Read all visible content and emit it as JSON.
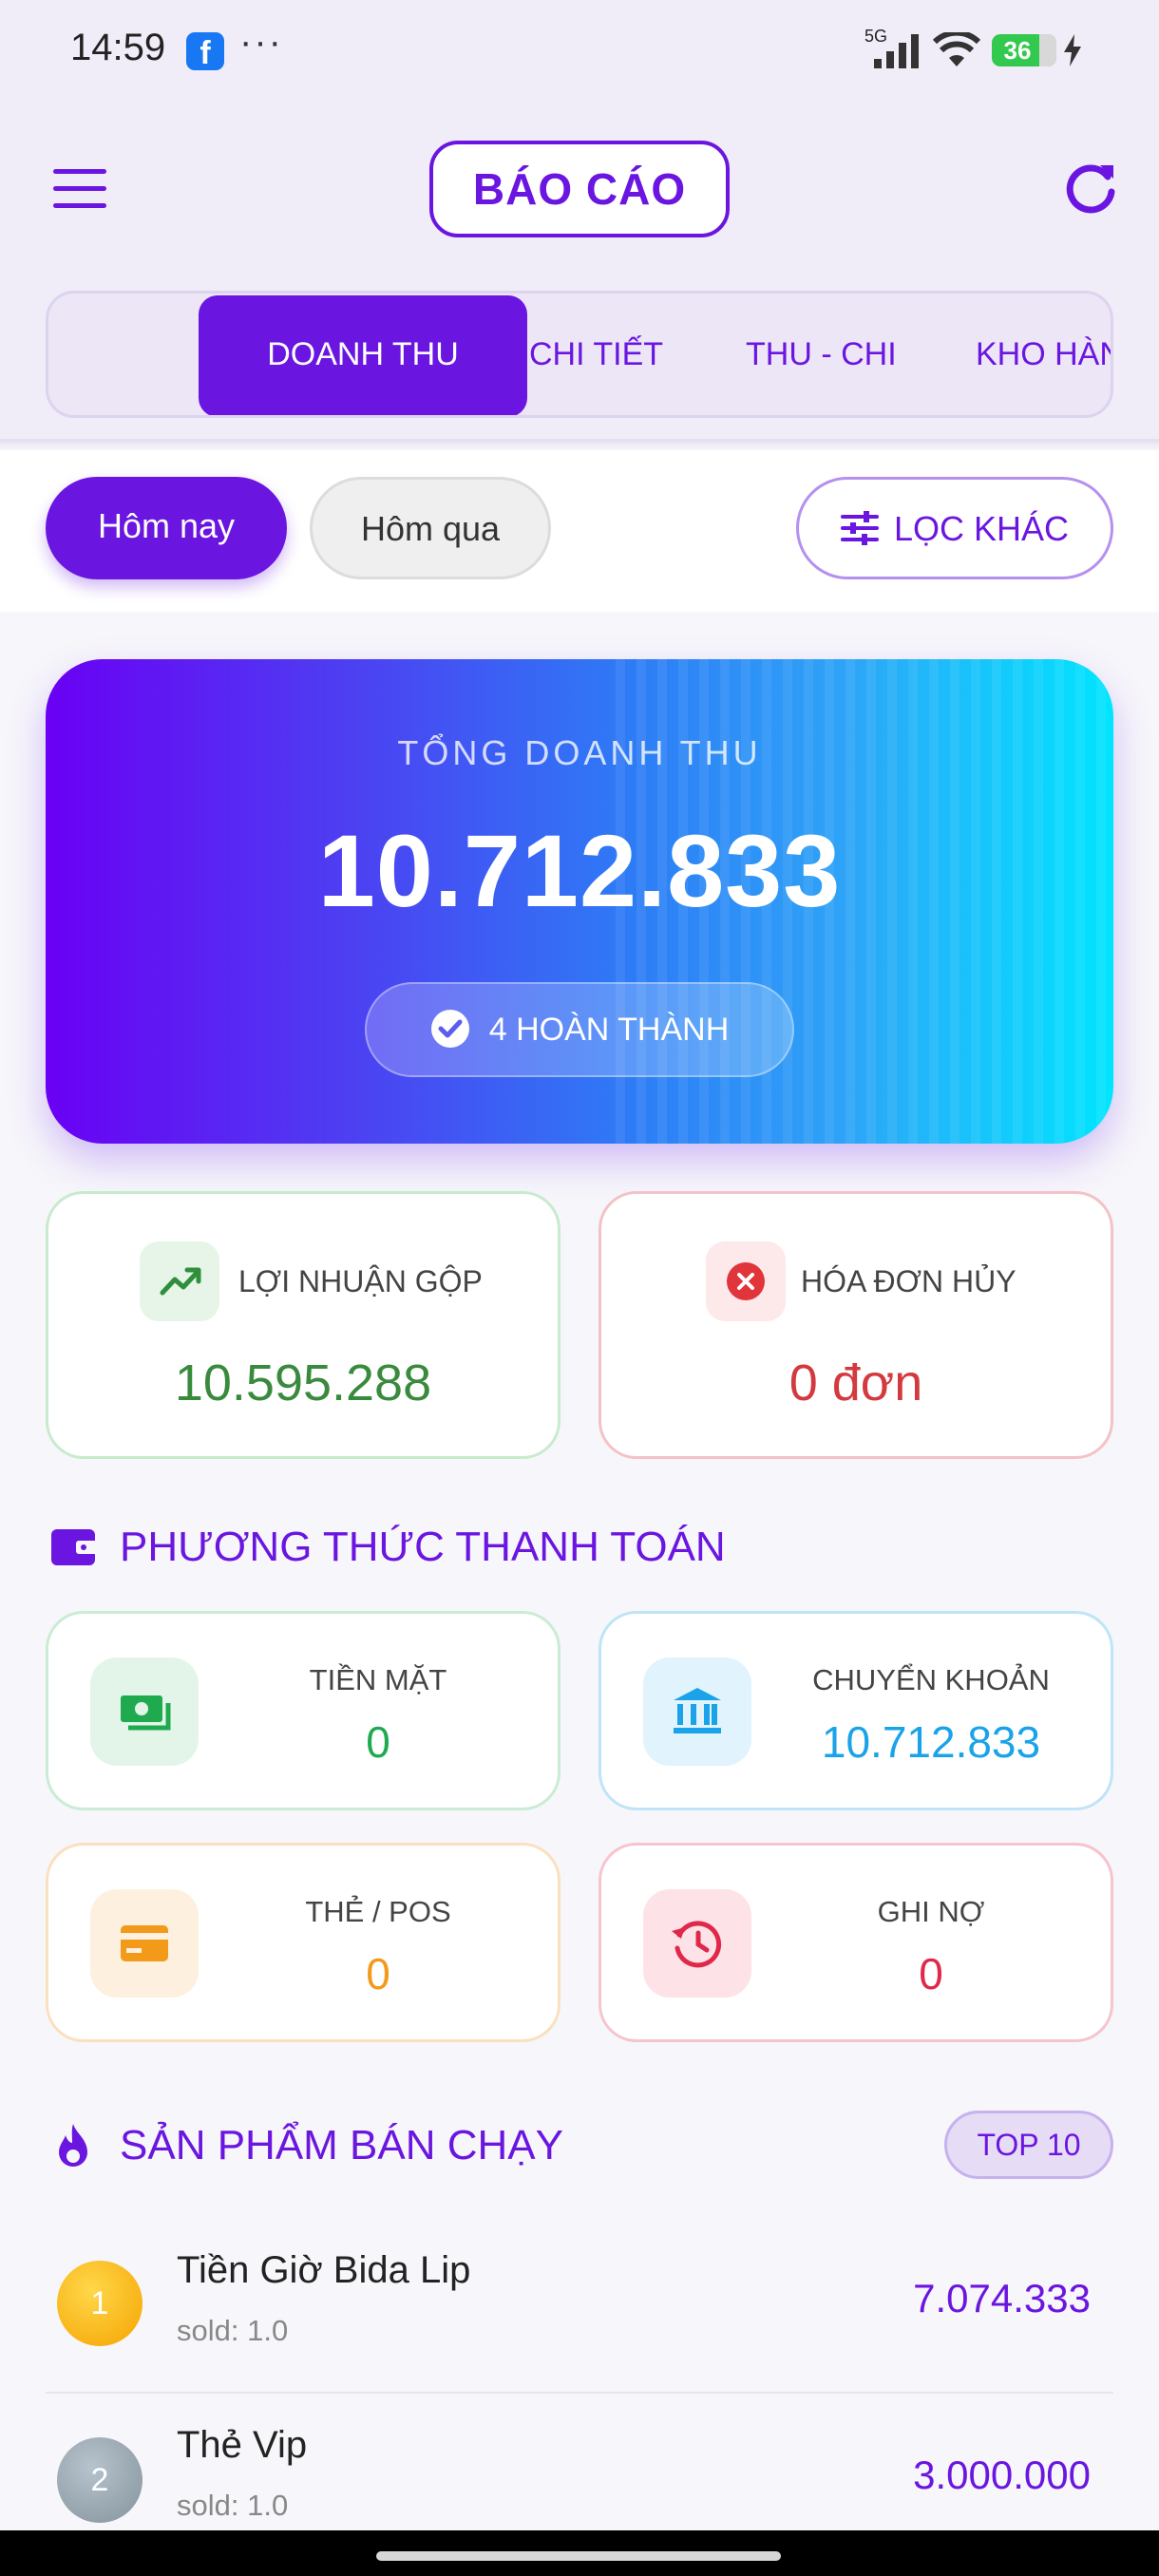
{
  "status_bar": {
    "time": "14:59",
    "app_icon": "facebook-icon",
    "overflow": "···",
    "network": "5G",
    "battery": "36"
  },
  "header": {
    "title": "BÁO CÁO",
    "menu_icon": "hamburger-icon",
    "refresh_icon": "refresh-icon"
  },
  "tabs": [
    {
      "label": "DOANH THU",
      "active": true
    },
    {
      "label": "CHI TIẾT",
      "active": false
    },
    {
      "label": "THU - CHI",
      "active": false
    },
    {
      "label": "KHO HÀN",
      "active": false
    }
  ],
  "filters": {
    "today": "Hôm nay",
    "yesterday": "Hôm qua",
    "more": "LỌC KHÁC"
  },
  "revenue": {
    "label": "TỔNG DOANH THU",
    "value": "10.712.833",
    "completed": "4 HOÀN THÀNH"
  },
  "stats": {
    "profit": {
      "label": "LỢI NHUẬN GỘP",
      "value": "10.595.288",
      "color": "#3a8a3e"
    },
    "cancelled": {
      "label": "HÓA ĐƠN HỦY",
      "value": "0 đơn",
      "color": "#d33a3f"
    }
  },
  "payment": {
    "title": "PHƯƠNG THỨC THANH TOÁN",
    "methods": [
      {
        "label": "TIỀN MẶT",
        "value": "0",
        "icon": "cash-icon",
        "color": "#1faa4f"
      },
      {
        "label": "CHUYỂN KHOẢN",
        "value": "10.712.833",
        "icon": "bank-icon",
        "color": "#1aa3e8"
      },
      {
        "label": "THẺ / POS",
        "value": "0",
        "icon": "credit-card-icon",
        "color": "#f39a1b"
      },
      {
        "label": "GHI NỢ",
        "value": "0",
        "icon": "history-icon",
        "color": "#e0294a"
      }
    ]
  },
  "best_sellers": {
    "title": "SẢN PHẨM BÁN CHẠY",
    "badge": "TOP 10",
    "items": [
      {
        "rank": "1",
        "name": "Tiền Giờ Bida Lip",
        "sold": "sold: 1.0",
        "value": "7.074.333"
      },
      {
        "rank": "2",
        "name": "Thẻ Vip",
        "sold": "sold: 1.0",
        "value": "3.000.000"
      }
    ]
  }
}
